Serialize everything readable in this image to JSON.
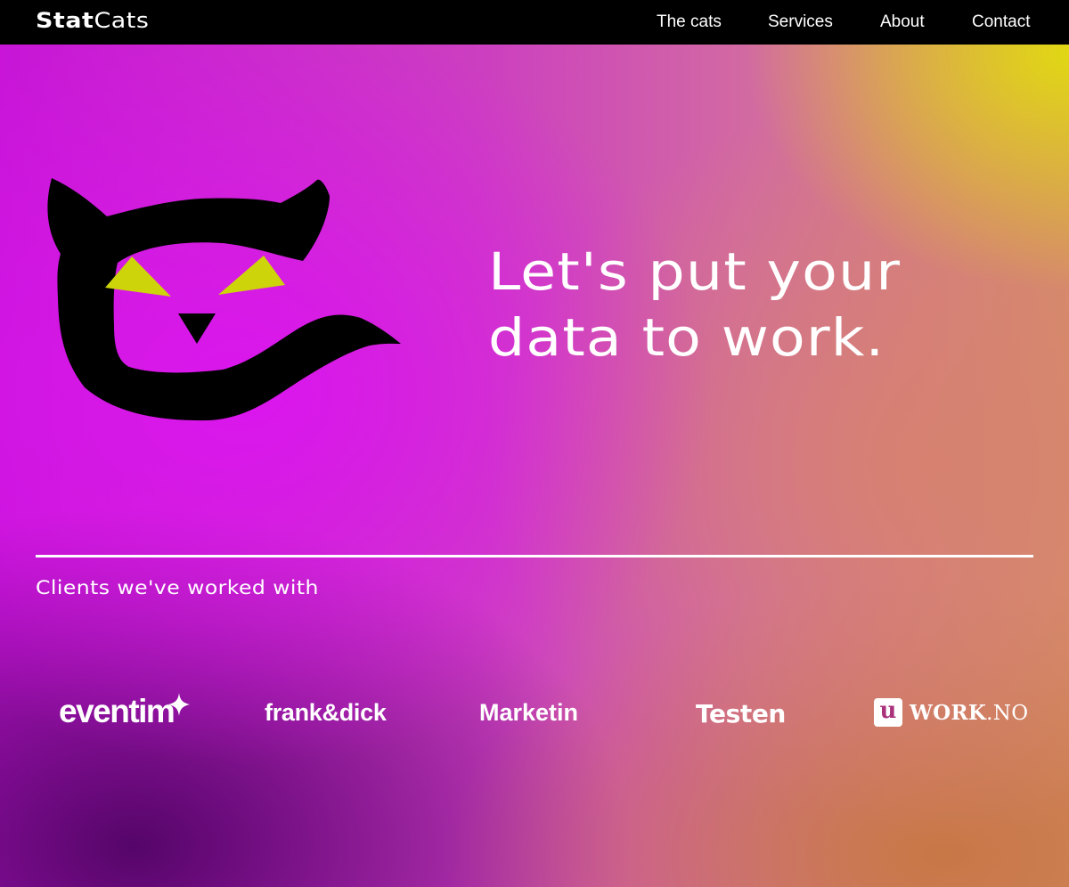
{
  "brand": {
    "name_bold": "Stat",
    "name_light": "Cats"
  },
  "nav": {
    "items": [
      {
        "label": "The cats"
      },
      {
        "label": "Services"
      },
      {
        "label": "About"
      },
      {
        "label": "Contact"
      }
    ]
  },
  "hero": {
    "headline_line1": "Let's put your",
    "headline_line2": "data to work.",
    "mascot_icon": "cat-logo-icon"
  },
  "clients": {
    "heading": "Clients we've worked with",
    "logos": [
      {
        "name": "eventim"
      },
      {
        "name": "frank&dick"
      },
      {
        "name": "Marketin"
      },
      {
        "name": "Testen"
      },
      {
        "badge": "u",
        "name_bold": "WORK",
        "name_light": ".NO"
      }
    ]
  },
  "colors": {
    "nav_background": "#000000",
    "text": "#ffffff",
    "cat_body": "#000000",
    "cat_eyes": "#cdd40a",
    "gradient_magenta": "#d815e8",
    "gradient_yellow": "#e1d514",
    "gradient_orange": "#c87846",
    "gradient_purple": "#55056a"
  }
}
